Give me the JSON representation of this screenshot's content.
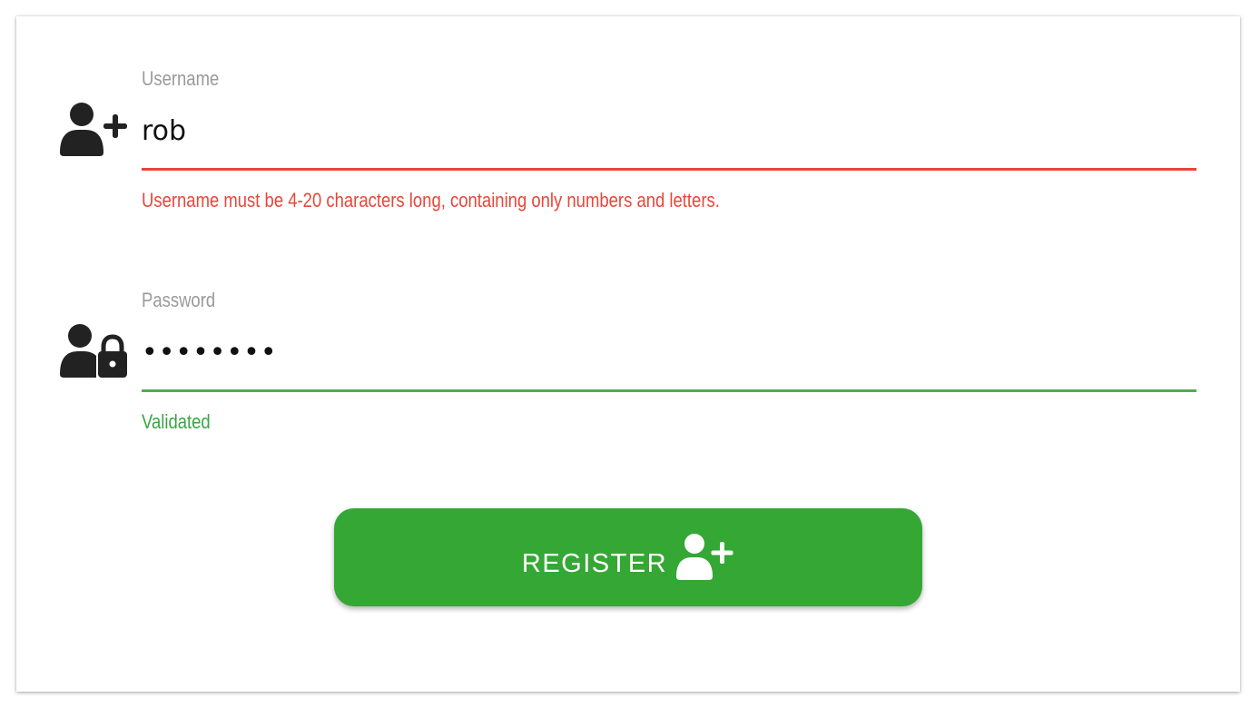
{
  "form": {
    "username": {
      "label": "Username",
      "value": "rob",
      "icon": "user-plus-icon",
      "status": "error",
      "helper": "Username must be 4-20 characters long, containing only numbers and letters."
    },
    "password": {
      "label": "Password",
      "value": "••••••••",
      "icon": "user-lock-icon",
      "status": "valid",
      "helper": "Validated"
    },
    "register_button": {
      "label": "REGISTER",
      "icon": "user-plus-icon"
    }
  },
  "colors": {
    "error": "#e8463a",
    "valid": "#4caf50",
    "valid_text": "#3aa544",
    "button": "#34a734",
    "label": "#9a9a9a",
    "icon": "#222222"
  }
}
